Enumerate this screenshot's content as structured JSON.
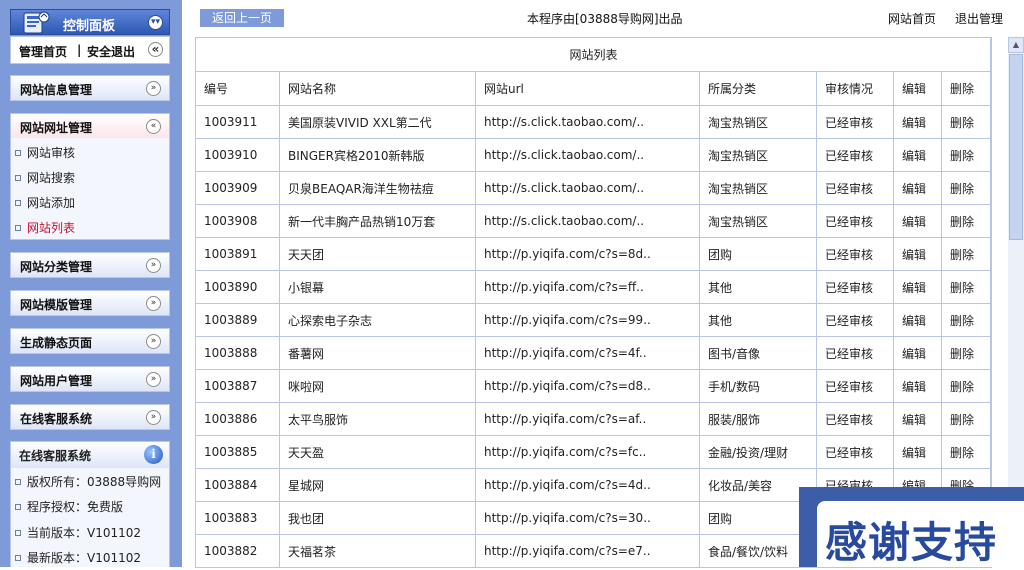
{
  "sidebar": {
    "panel_title": "控制面板",
    "top_links": {
      "home": "管理首页",
      "separator": "|",
      "logout": "安全退出"
    },
    "menus": [
      {
        "label": "网站信息管理"
      },
      {
        "label": "网站网址管理",
        "items": [
          {
            "label": "网站审核"
          },
          {
            "label": "网站搜索"
          },
          {
            "label": "网站添加"
          },
          {
            "label": "网站列表"
          }
        ]
      },
      {
        "label": "网站分类管理"
      },
      {
        "label": "网站模版管理"
      },
      {
        "label": "生成静态页面"
      },
      {
        "label": "网站用户管理"
      },
      {
        "label": "在线客服系统"
      }
    ],
    "info": {
      "title": "在线客服系统",
      "lines": [
        "版权所有：03888导购网",
        "程序授权：免费版",
        "当前版本：V101102",
        "最新版本：V101102"
      ]
    },
    "colors": {
      "background": "#7e9ad8",
      "current_item": "#c8102e"
    }
  },
  "topbar": {
    "back_label": "返回上一页",
    "credit": "本程序由[03888导购网]出品",
    "site_home": "网站首页",
    "logout": "退出管理"
  },
  "table": {
    "caption": "网站列表",
    "headers": [
      "编号",
      "网站名称",
      "网站url",
      "所属分类",
      "审核情况",
      "编辑",
      "删除"
    ],
    "rows": [
      {
        "id": "1003911",
        "name": "美国原装VIVID XXL第二代",
        "url": "http://s.click.taobao.com/..",
        "category": "淘宝热销区",
        "status": "已经审核",
        "edit": "编辑",
        "del": "删除"
      },
      {
        "id": "1003910",
        "name": "BINGER宾格2010新韩版",
        "url": "http://s.click.taobao.com/..",
        "category": "淘宝热销区",
        "status": "已经审核",
        "edit": "编辑",
        "del": "删除"
      },
      {
        "id": "1003909",
        "name": "贝泉BEAQAR海洋生物祛痘",
        "url": "http://s.click.taobao.com/..",
        "category": "淘宝热销区",
        "status": "已经审核",
        "edit": "编辑",
        "del": "删除"
      },
      {
        "id": "1003908",
        "name": "新一代丰胸产品热销10万套",
        "url": "http://s.click.taobao.com/..",
        "category": "淘宝热销区",
        "status": "已经审核",
        "edit": "编辑",
        "del": "删除"
      },
      {
        "id": "1003891",
        "name": "天天团",
        "url": "http://p.yiqifa.com/c?s=8d..",
        "category": "团购",
        "status": "已经审核",
        "edit": "编辑",
        "del": "删除"
      },
      {
        "id": "1003890",
        "name": "小银幕",
        "url": "http://p.yiqifa.com/c?s=ff..",
        "category": "其他",
        "status": "已经审核",
        "edit": "编辑",
        "del": "删除"
      },
      {
        "id": "1003889",
        "name": "心探索电子杂志",
        "url": "http://p.yiqifa.com/c?s=99..",
        "category": "其他",
        "status": "已经审核",
        "edit": "编辑",
        "del": "删除"
      },
      {
        "id": "1003888",
        "name": "番薯网",
        "url": "http://p.yiqifa.com/c?s=4f..",
        "category": "图书/音像",
        "status": "已经审核",
        "edit": "编辑",
        "del": "删除"
      },
      {
        "id": "1003887",
        "name": "咪啦网",
        "url": "http://p.yiqifa.com/c?s=d8..",
        "category": "手机/数码",
        "status": "已经审核",
        "edit": "编辑",
        "del": "删除"
      },
      {
        "id": "1003886",
        "name": "太平鸟服饰",
        "url": "http://p.yiqifa.com/c?s=af..",
        "category": "服装/服饰",
        "status": "已经审核",
        "edit": "编辑",
        "del": "删除"
      },
      {
        "id": "1003885",
        "name": "天天盈",
        "url": "http://p.yiqifa.com/c?s=fc..",
        "category": "金融/投资/理财",
        "status": "已经审核",
        "edit": "编辑",
        "del": "删除"
      },
      {
        "id": "1003884",
        "name": "星城网",
        "url": "http://p.yiqifa.com/c?s=4d..",
        "category": "化妆品/美容",
        "status": "已经审核",
        "edit": "编辑",
        "del": "删除"
      },
      {
        "id": "1003883",
        "name": "我也团",
        "url": "http://p.yiqifa.com/c?s=30..",
        "category": "团购",
        "status": "",
        "edit": "",
        "del": ""
      },
      {
        "id": "1003882",
        "name": "天福茗茶",
        "url": "http://p.yiqifa.com/c?s=e7..",
        "category": "食品/餐饮/饮料",
        "status": "",
        "edit": "",
        "del": ""
      }
    ]
  },
  "banner": {
    "text": "感谢支持"
  },
  "icons": {
    "logo": "control-panel-logo-icon",
    "expand": "chevron-down-icon",
    "collapse": "chevron-up-icon",
    "info": "info-icon",
    "panel_toggle": "double-chevron-left-icon"
  }
}
